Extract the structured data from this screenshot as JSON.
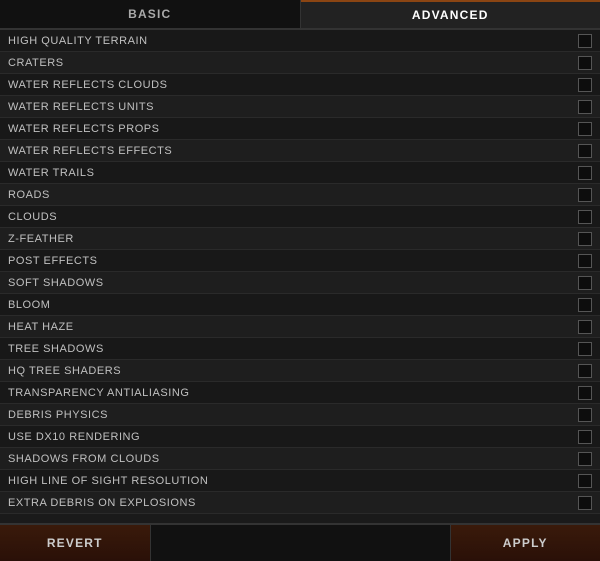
{
  "tabs": [
    {
      "label": "BASIC",
      "active": false
    },
    {
      "label": "ADVANCED",
      "active": true
    }
  ],
  "settings": [
    {
      "label": "HIGH QUALITY TERRAIN",
      "checked": false
    },
    {
      "label": "CRATERS",
      "checked": false
    },
    {
      "label": "WATER REFLECTS CLOUDS",
      "checked": false
    },
    {
      "label": "WATER REFLECTS UNITS",
      "checked": false
    },
    {
      "label": "WATER REFLECTS PROPS",
      "checked": false
    },
    {
      "label": "WATER REFLECTS EFFECTS",
      "checked": false
    },
    {
      "label": "WATER TRAILS",
      "checked": false
    },
    {
      "label": "ROADS",
      "checked": false
    },
    {
      "label": "CLOUDS",
      "checked": false
    },
    {
      "label": "Z-FEATHER",
      "checked": false
    },
    {
      "label": "POST EFFECTS",
      "checked": false
    },
    {
      "label": "SOFT SHADOWS",
      "checked": false
    },
    {
      "label": "BLOOM",
      "checked": false
    },
    {
      "label": "HEAT HAZE",
      "checked": false
    },
    {
      "label": "TREE SHADOWS",
      "checked": false
    },
    {
      "label": "HQ TREE SHADERS",
      "checked": false
    },
    {
      "label": "TRANSPARENCY ANTIALIASING",
      "checked": false
    },
    {
      "label": "DEBRIS PHYSICS",
      "checked": false
    },
    {
      "label": "USE DX10 RENDERING",
      "checked": false
    },
    {
      "label": "SHADOWS FROM CLOUDS",
      "checked": false
    },
    {
      "label": "HIGH LINE OF SIGHT RESOLUTION",
      "checked": false
    },
    {
      "label": "EXTRA DEBRIS ON EXPLOSIONS",
      "checked": false
    }
  ],
  "buttons": {
    "revert": "REVERT",
    "apply": "APPLY"
  }
}
